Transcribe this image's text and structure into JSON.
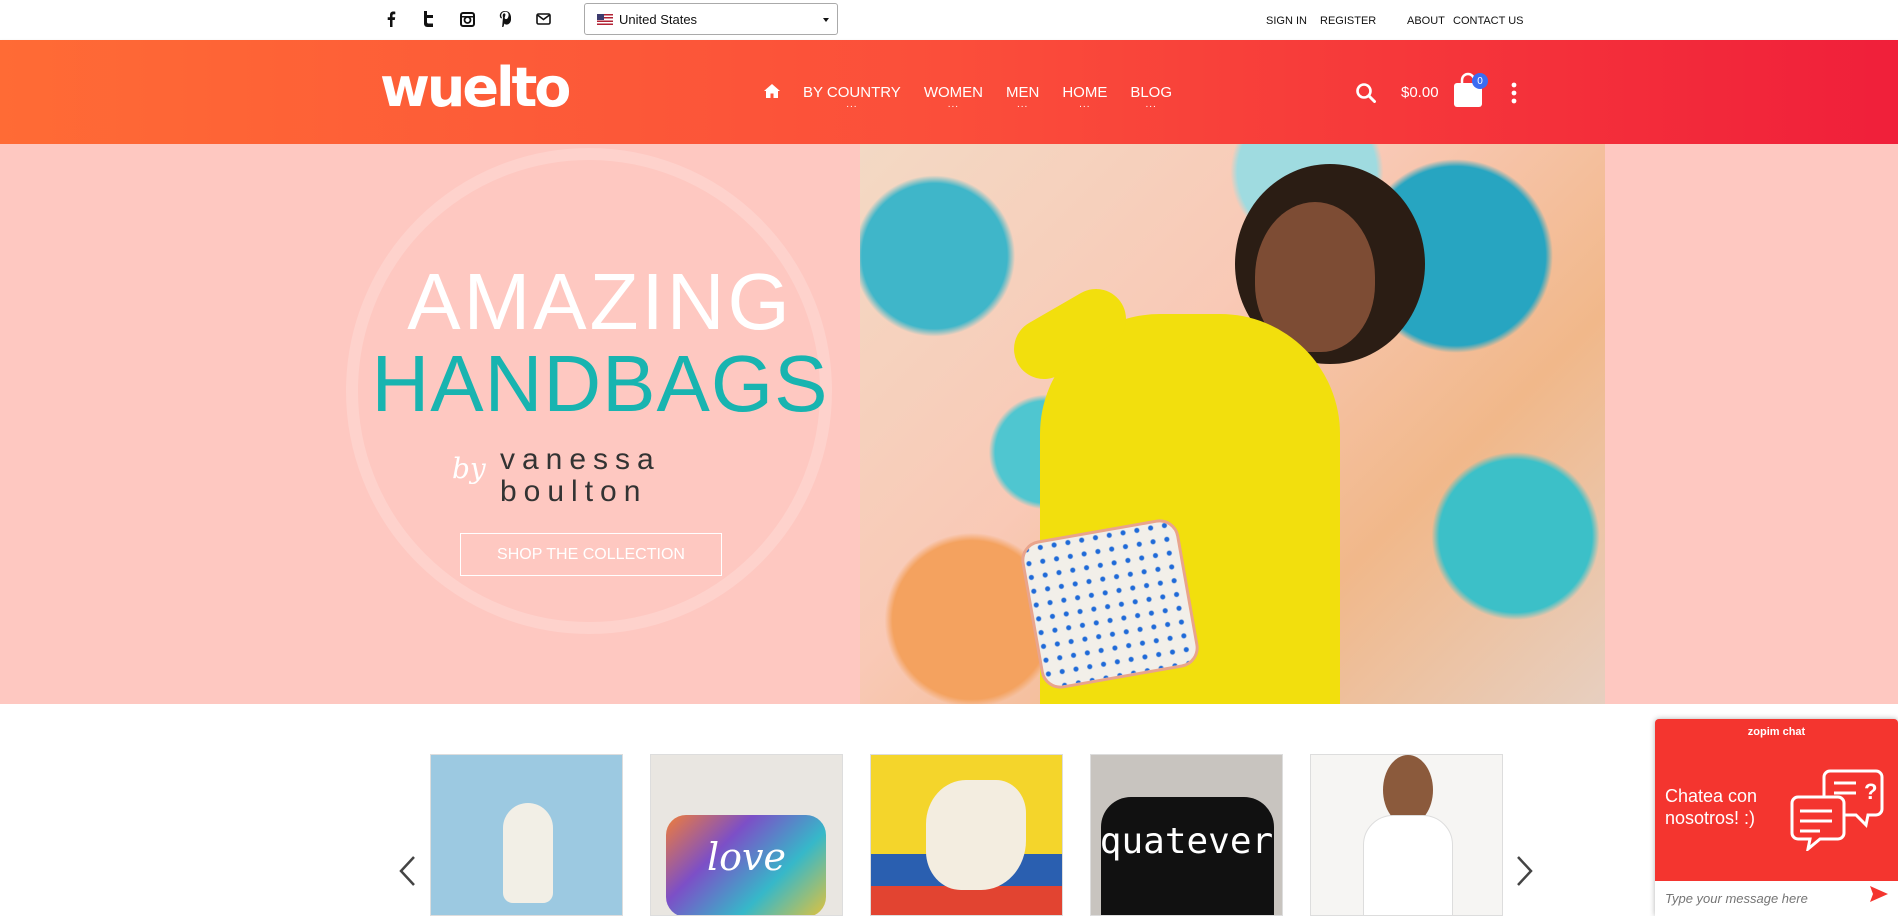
{
  "topbar": {
    "social_icons": [
      "facebook-icon",
      "twitter-icon",
      "instagram-icon",
      "pinterest-icon",
      "mail-icon"
    ],
    "country_select": "United States",
    "links": [
      "SIGN IN",
      "REGISTER",
      "ABOUT",
      "CONTACT US"
    ]
  },
  "header": {
    "logo": "wuelto",
    "nav": [
      "BY COUNTRY",
      "WOMEN",
      "MEN",
      "HOME",
      "BLOG"
    ],
    "nav_dots": "...",
    "cart_total": "$0.00",
    "cart_count": "0",
    "colors": {
      "gradient_start": "#ff6b35",
      "gradient_end": "#f01f3a",
      "badge": "#3b6cf2"
    }
  },
  "hero": {
    "line1": "AMAZING",
    "line2": "HANDBAGS",
    "by": "by",
    "brand_line1": "vanessa",
    "brand_line2": "boulton",
    "cta": "SHOP THE COLLECTION",
    "colors": {
      "background": "#fec8c1",
      "accent": "#18b4b0"
    }
  },
  "carousel": {
    "cards": [
      {
        "name": "blue-tshirt"
      },
      {
        "name": "venezuela-love-print"
      },
      {
        "name": "colombia-pillow"
      },
      {
        "name": "quatever-tshirt",
        "text": "quatever"
      },
      {
        "name": "white-tshirt-woman"
      }
    ],
    "love_text": "love"
  },
  "chat": {
    "brand": "zopim chat",
    "message": "Chatea con nosotros! :)",
    "placeholder": "Type your message here",
    "color": "#f4352f"
  }
}
